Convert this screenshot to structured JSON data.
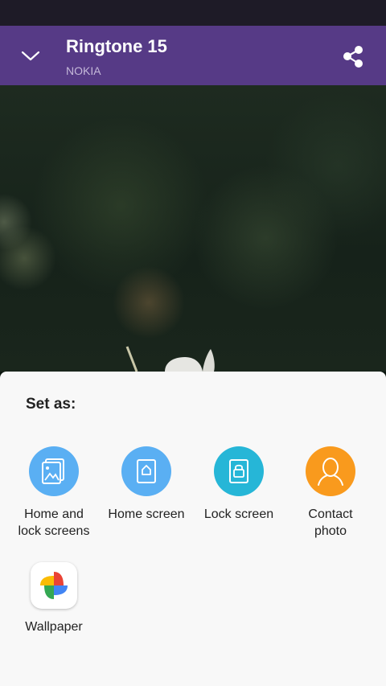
{
  "app": {
    "title": "Ringtone 15",
    "subtitle": "NOKIA"
  },
  "sheet": {
    "title": "Set as:",
    "options": [
      {
        "label_line1": "Home and",
        "label_line2": "lock screens",
        "icon": "home-and-lock-icon",
        "color": "#5aaff3"
      },
      {
        "label_line1": "Home screen",
        "label_line2": "",
        "icon": "home-screen-icon",
        "color": "#5aaff3"
      },
      {
        "label_line1": "Lock screen",
        "label_line2": "",
        "icon": "lock-screen-icon",
        "color": "#26b6d7"
      },
      {
        "label_line1": "Contact",
        "label_line2": "photo",
        "icon": "contact-icon",
        "color": "#f99a1d"
      },
      {
        "label_line1": "Wallpaper",
        "label_line2": "",
        "icon": "google-photos-pinwheel-icon",
        "color": "#ffffff"
      }
    ]
  },
  "colors": {
    "toolbar": "#563a86",
    "status_bar": "#1e1b27",
    "sheet_background": "#f8f8f8"
  }
}
